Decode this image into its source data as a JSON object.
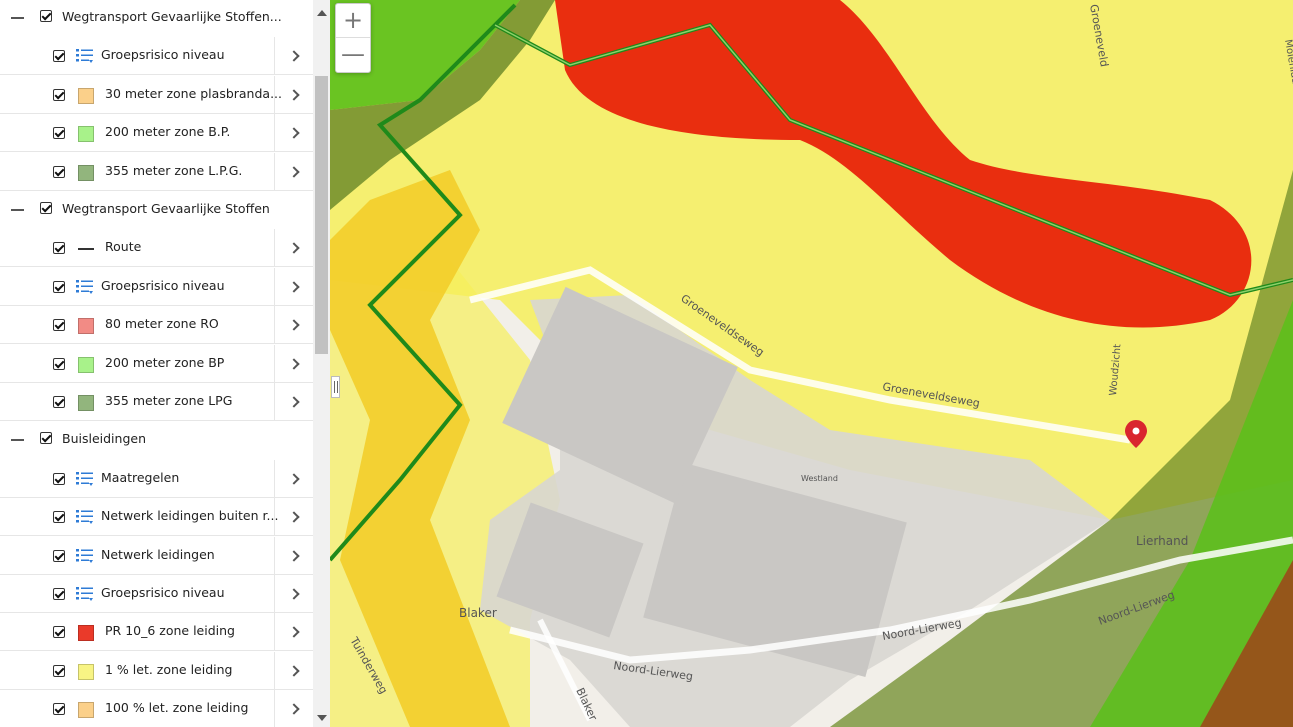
{
  "layers": [
    {
      "label": "Wegtransport Gevaarlijke Stoffen...",
      "children": [
        {
          "label": "Groepsrisico niveau",
          "icon": "list-icon"
        },
        {
          "label": "30 meter zone plasbranda...",
          "swatch": "#fbd08a"
        },
        {
          "label": "200 meter zone B.P.",
          "swatch": "#a8f28a"
        },
        {
          "label": "355 meter zone L.P.G.",
          "swatch": "#92b57d"
        }
      ]
    },
    {
      "label": "Wegtransport Gevaarlijke Stoffen",
      "children": [
        {
          "label": "Route",
          "icon": "line-icon"
        },
        {
          "label": "Groepsrisico niveau",
          "icon": "list-icon"
        },
        {
          "label": "80 meter zone RO",
          "swatch": "#f28b85"
        },
        {
          "label": "200 meter zone BP",
          "swatch": "#a8f28a"
        },
        {
          "label": "355 meter zone LPG",
          "swatch": "#92b57d"
        }
      ]
    },
    {
      "label": "Buisleidingen",
      "children": [
        {
          "label": "Maatregelen",
          "icon": "list-icon"
        },
        {
          "label": "Netwerk leidingen buiten r...",
          "icon": "list-icon"
        },
        {
          "label": "Netwerk leidingen",
          "icon": "list-icon"
        },
        {
          "label": "Groepsrisico niveau",
          "icon": "list-icon"
        },
        {
          "label": "PR 10_6 zone leiding",
          "swatch": "#ea3a2a"
        },
        {
          "label": "1 % let. zone leiding",
          "swatch": "#f8f484"
        },
        {
          "label": "100 % let. zone leiding",
          "swatch": "#fbd08a"
        }
      ]
    }
  ],
  "map": {
    "zoom_in": "+",
    "zoom_out": "—",
    "labels": {
      "groeneveld": "Groeneveld",
      "groeneveldseweg_1": "Groeneveldseweg",
      "groeneveldseweg_2": "Groeneveldseweg",
      "westland": "Westland",
      "lierhand": "Lierhand",
      "noord_lierweg_1": "Noord-Lierweg",
      "noord_lierweg_2": "Noord-Lierweg",
      "noord_lierweg_3": "Noord-Lierweg",
      "blaker_1": "Blaker",
      "blaker_2": "Blaker",
      "woudzicht": "Woudzicht",
      "molenlaan": "Molenlaan",
      "tuinderweg": "Tuinderweg"
    },
    "colors": {
      "red_zone": "#e8230a",
      "yellow_zone": "#f6ef5a",
      "orange_zone": "#f3cd2a",
      "green_zone": "#5bbf1a",
      "olive_zone": "#6f8c2a",
      "brown_zone": "#9b4a1a",
      "pipeline": "#1f8a1a"
    }
  }
}
